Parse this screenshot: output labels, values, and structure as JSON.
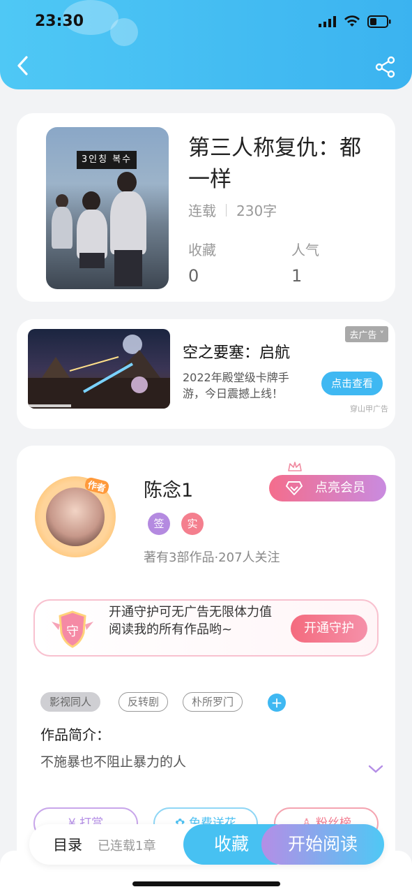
{
  "status_bar": {
    "time": "23:30"
  },
  "header": {
    "back_icon": "chevron-left-icon",
    "share_icon": "share-icon"
  },
  "book": {
    "title": "第三人称复仇：都一样",
    "status": "连载",
    "word_count": "230字",
    "favorites_label": "收藏",
    "favorites_value": "0",
    "popularity_label": "人气",
    "popularity_value": "1",
    "cover_text": "3인칭 복수"
  },
  "ad": {
    "title": "空之要塞：启航",
    "desc": "2022年殿堂级卡牌手游，今日震撼上线！",
    "close_label": "去广告",
    "cta_label": "点击查看",
    "source": "穿山甲广告"
  },
  "author": {
    "tag": "作者",
    "name": "陈念1",
    "vip_label": "点亮会员",
    "badge_sign": "签",
    "badge_real": "实",
    "works_line": "著有3部作品·207人关注"
  },
  "guard": {
    "icon_text": "守",
    "text": "开通守护可无广告无限体力值阅读我的所有作品哟~",
    "button": "开通守护"
  },
  "tags": [
    "影视同人",
    "反转剧",
    "朴所罗门"
  ],
  "intro": {
    "heading": "作品简介：",
    "text": "不施暴也不阻止暴力的人"
  },
  "actions": {
    "tip": "打赏",
    "flower": "免费送花",
    "fans": "粉丝榜"
  },
  "bottom": {
    "toc_label": "目录",
    "toc_sub": "已连载1章",
    "favorite_button": "收藏",
    "read_button": "开始阅读"
  },
  "colors": {
    "primary": "#3fb8f2",
    "vip_gradient_start": "#f46d8c",
    "vip_gradient_end": "#c98be0",
    "guard_button": "#f46b7e"
  }
}
